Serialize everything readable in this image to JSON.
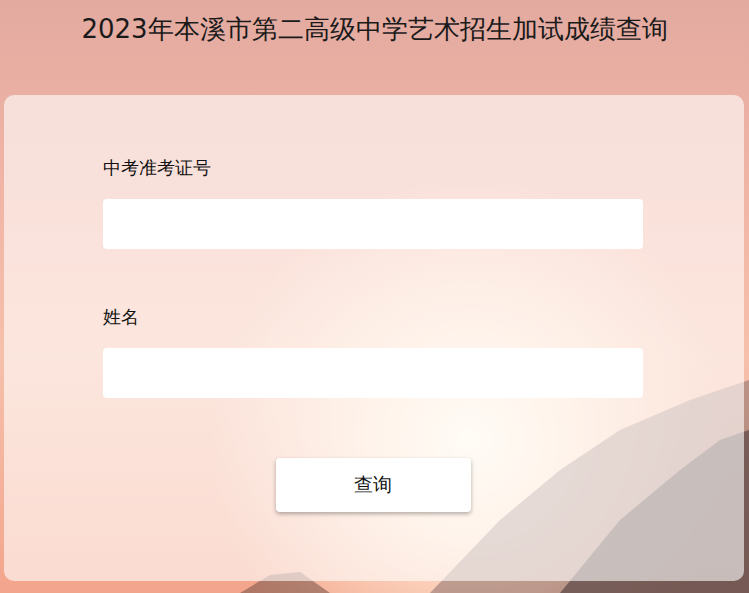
{
  "page": {
    "title": "2023年本溪市第二高级中学艺术招生加试成绩查询"
  },
  "form": {
    "fields": [
      {
        "label": "中考准考证号",
        "value": ""
      },
      {
        "label": "姓名",
        "value": ""
      }
    ],
    "submit": {
      "label": "查询"
    }
  }
}
